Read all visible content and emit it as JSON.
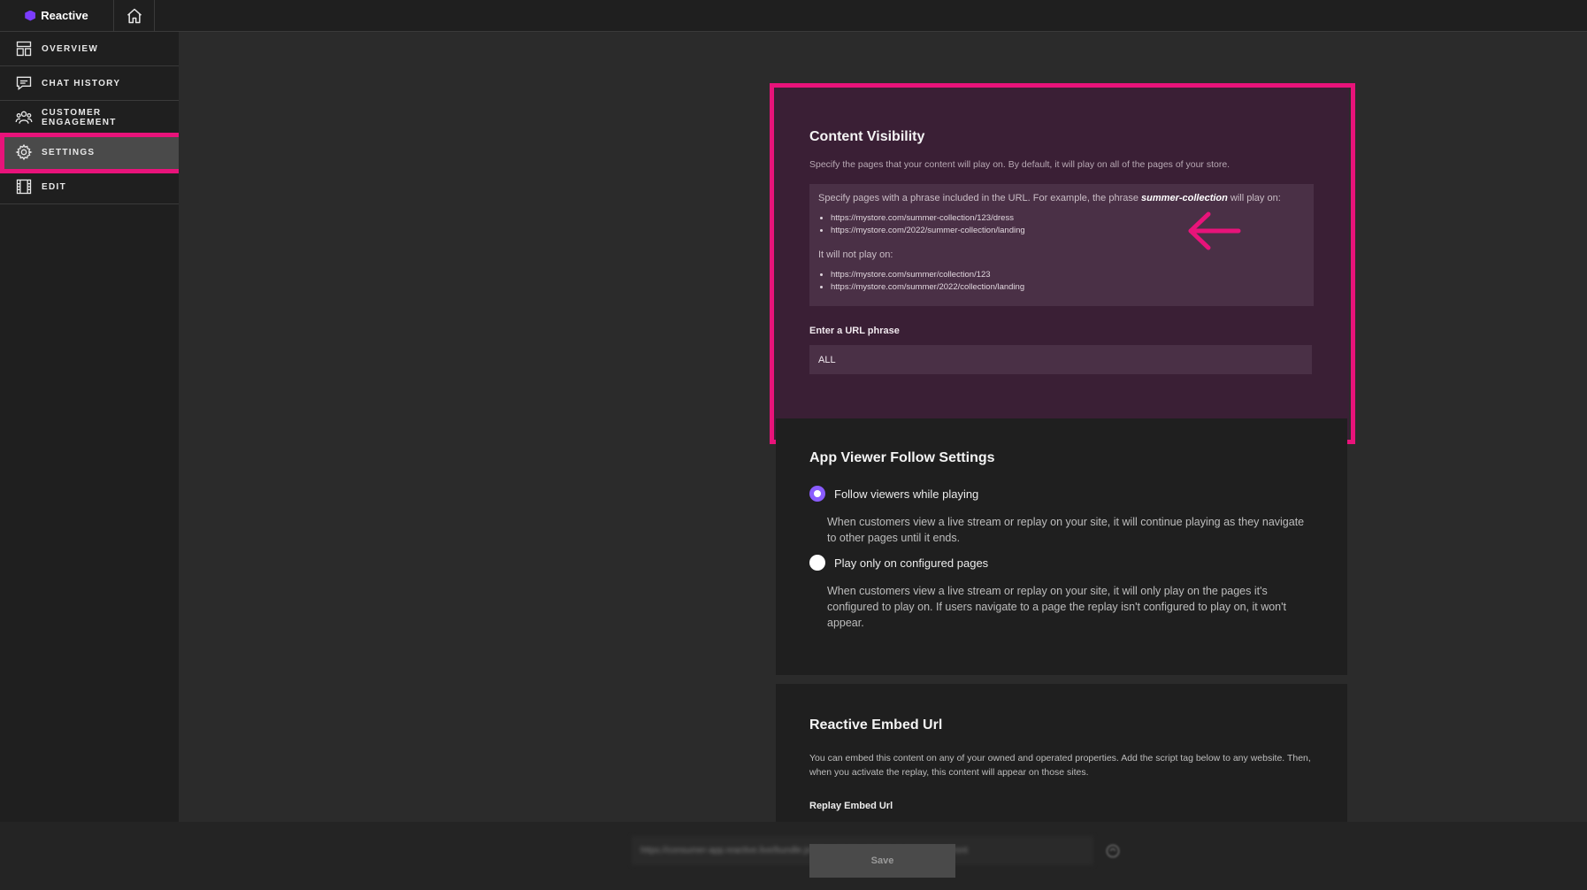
{
  "app": {
    "name": "Reactive"
  },
  "sidebar": {
    "items": [
      {
        "label": "OVERVIEW",
        "icon": "overview-icon"
      },
      {
        "label": "CHAT HISTORY",
        "icon": "chat-icon"
      },
      {
        "label": "CUSTOMER ENGAGEMENT",
        "icon": "users-icon"
      },
      {
        "label": "SETTINGS",
        "icon": "gear-icon",
        "active": true
      },
      {
        "label": "EDIT",
        "icon": "film-icon"
      }
    ]
  },
  "content_visibility": {
    "title": "Content Visibility",
    "description": "Specify the pages that your content will play on. By default, it will play on all of the pages of your store.",
    "example_intro_before": "Specify pages with a phrase included in the URL. For example, the phrase ",
    "example_phrase": "summer-collection",
    "example_intro_after": " will play on:",
    "plays_on": [
      "https://mystore.com/summer-collection/123/dress",
      "https://mystore.com/2022/summer-collection/landing"
    ],
    "not_play_label": "It will not play on:",
    "not_plays_on": [
      "https://mystore.com/summer/collection/123",
      "https://mystore.com/summer/2022/collection/landing"
    ],
    "input_label": "Enter a URL phrase",
    "input_value": "ALL"
  },
  "follow_settings": {
    "title": "App Viewer Follow Settings",
    "options": [
      {
        "label": "Follow viewers while playing",
        "selected": true,
        "description": "When customers view a live stream or replay on your site, it will continue playing as they navigate to other pages until it ends."
      },
      {
        "label": "Play only on configured pages",
        "selected": false,
        "description": "When customers view a live stream or replay on your site, it will only play on the pages it's configured to play on. If users navigate to a page the replay isn't configured to play on, it won't appear."
      }
    ]
  },
  "embed": {
    "title": "Reactive Embed Url",
    "description": "You can embed this content on any of your owned and operated properties. Add the script tag below to any website. Then, when you activate the replay, this content will appear on those sites.",
    "field_label": "Replay Embed Url",
    "field_value": "https://consumer-app.reactive.live/bundle.js?showId=3bacf-c83bafe6308&storefront"
  },
  "footer": {
    "save_label": "Save"
  },
  "colors": {
    "highlight": "#e8137a",
    "accent": "#8a5cff"
  }
}
